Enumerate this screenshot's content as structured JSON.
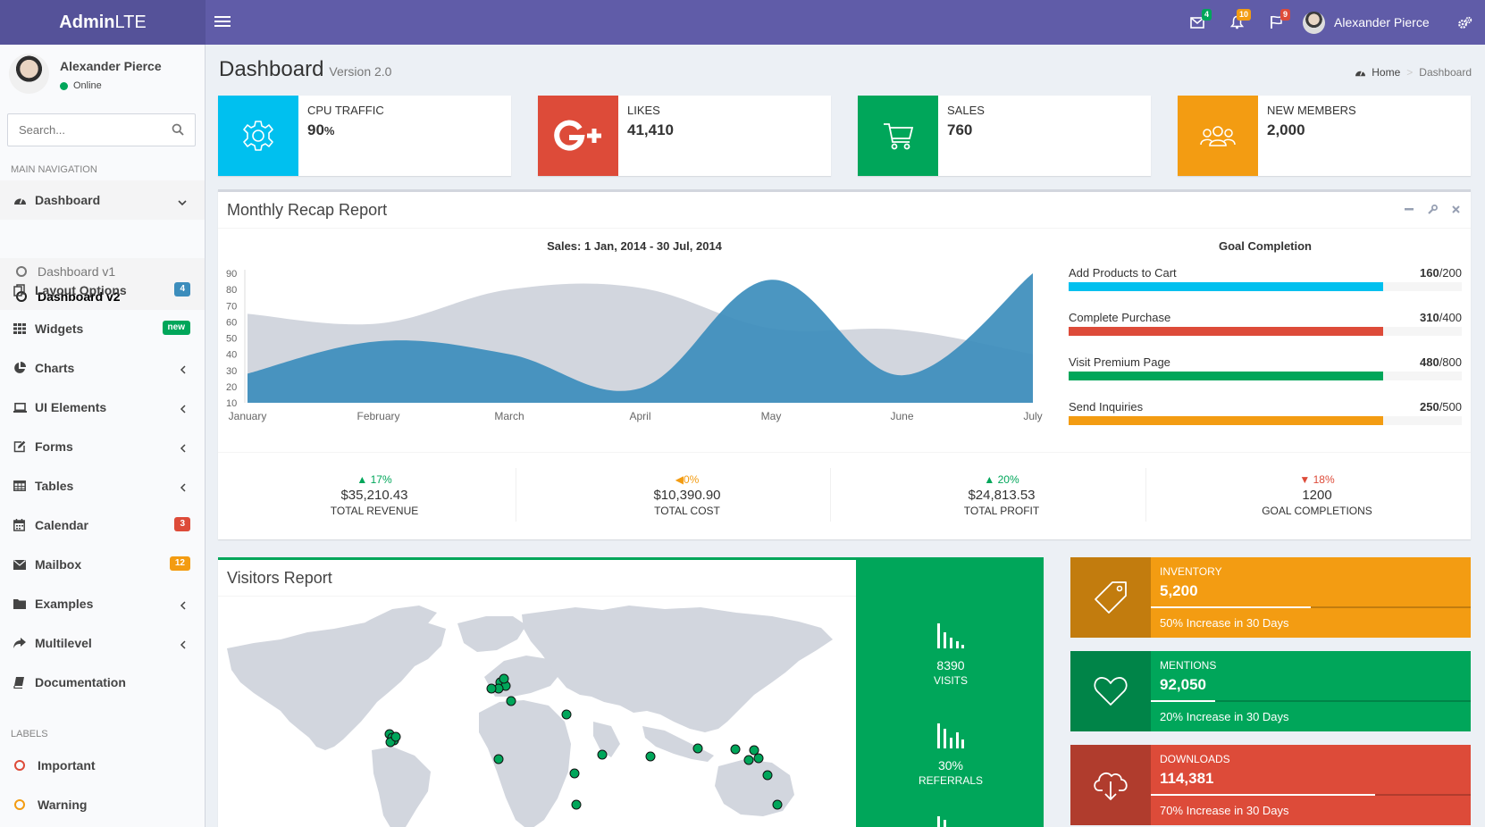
{
  "header": {
    "logo_bold": "Admin",
    "logo_rest": "LTE",
    "mail_badge": "4",
    "bell_badge": "10",
    "flag_badge": "9",
    "user_name": "Alexander Pierce"
  },
  "sidebar": {
    "user_name": "Alexander Pierce",
    "status": "Online",
    "search_placeholder": "Search...",
    "main_nav_header": "MAIN NAVIGATION",
    "labels_header": "LABELS",
    "dashboard": "Dashboard",
    "dashboard_v1": "Dashboard v1",
    "dashboard_v2": "Dashboard v2",
    "layout_options": "Layout Options",
    "layout_badge": "4",
    "widgets": "Widgets",
    "widgets_badge": "new",
    "charts": "Charts",
    "ui_elements": "UI Elements",
    "forms": "Forms",
    "tables": "Tables",
    "calendar": "Calendar",
    "calendar_badge": "3",
    "mailbox": "Mailbox",
    "mailbox_badge": "12",
    "examples": "Examples",
    "multilevel": "Multilevel",
    "documentation": "Documentation",
    "label_important": "Important",
    "label_warning": "Warning"
  },
  "page": {
    "title": "Dashboard",
    "subtitle": "Version 2.0",
    "breadcrumb_home": "Home",
    "breadcrumb_current": "Dashboard"
  },
  "info_boxes": [
    {
      "text": "CPU TRAFFIC",
      "number": "90",
      "unit": "%",
      "color": "#00c0ef",
      "icon": "gear-icon"
    },
    {
      "text": "LIKES",
      "number": "41,410",
      "color": "#dd4b39",
      "icon": "google-plus-icon"
    },
    {
      "text": "SALES",
      "number": "760",
      "color": "#00a65a",
      "icon": "shopping-cart-icon"
    },
    {
      "text": "NEW MEMBERS",
      "number": "2,000",
      "color": "#f39c12",
      "icon": "users-icon"
    }
  ],
  "recap": {
    "title": "Monthly Recap Report",
    "chart_title": "Sales: 1 Jan, 2014 - 30 Jul, 2014",
    "goal_title": "Goal Completion",
    "goals": [
      {
        "label": "Add Products to Cart",
        "value": "160",
        "total": "/200",
        "color": "#00c0ef",
        "fraction": 0.8
      },
      {
        "label": "Complete Purchase",
        "value": "310",
        "total": "/400",
        "color": "#dd4b39",
        "fraction": 0.8
      },
      {
        "label": "Visit Premium Page",
        "value": "480",
        "total": "/800",
        "color": "#00a65a",
        "fraction": 0.8
      },
      {
        "label": "Send Inquiries",
        "value": "250",
        "total": "/500",
        "color": "#f39c12",
        "fraction": 0.8
      }
    ],
    "footer": [
      {
        "pct": "17%",
        "dir": "up",
        "color": "#00a65a",
        "amount": "$35,210.43",
        "title": "TOTAL REVENUE"
      },
      {
        "pct": "0%",
        "dir": "left",
        "color": "#f39c12",
        "amount": "$10,390.90",
        "title": "TOTAL COST"
      },
      {
        "pct": "20%",
        "dir": "up",
        "color": "#00a65a",
        "amount": "$24,813.53",
        "title": "TOTAL PROFIT"
      },
      {
        "pct": "18%",
        "dir": "down",
        "color": "#dd4b39",
        "amount": "1200",
        "title": "GOAL COMPLETIONS"
      }
    ]
  },
  "chart_data": {
    "type": "area",
    "title": "Sales: 1 Jan, 2014 - 30 Jul, 2014",
    "categories": [
      "January",
      "February",
      "March",
      "April",
      "May",
      "June",
      "July"
    ],
    "ylim": [
      10,
      90
    ],
    "yticks": [
      10,
      20,
      30,
      40,
      50,
      60,
      70,
      80,
      90
    ],
    "series": [
      {
        "values": [
          65,
          59,
          80,
          81,
          56,
          55,
          40
        ],
        "color": "#d2d6de"
      },
      {
        "values": [
          28,
          48,
          40,
          19,
          86,
          27,
          90
        ],
        "color": "#3c8dbc"
      }
    ]
  },
  "visitors": {
    "title": "Visitors Report",
    "visits_value": "8390",
    "visits_label": "VISITS",
    "referrals_value": "30%",
    "referrals_label": "REFERRALS"
  },
  "side_boxes": [
    {
      "text": "INVENTORY",
      "number": "5,200",
      "desc": "50% Increase in 30 Days",
      "progress": 0.5,
      "color": "#f39c12",
      "icon": "tag-icon"
    },
    {
      "text": "MENTIONS",
      "number": "92,050",
      "desc": "20% Increase in 30 Days",
      "progress": 0.2,
      "color": "#00a65a",
      "icon": "heart-icon"
    },
    {
      "text": "DOWNLOADS",
      "number": "114,381",
      "desc": "70% Increase in 30 Days",
      "progress": 0.7,
      "color": "#dd4b39",
      "icon": "cloud-download-icon"
    }
  ]
}
